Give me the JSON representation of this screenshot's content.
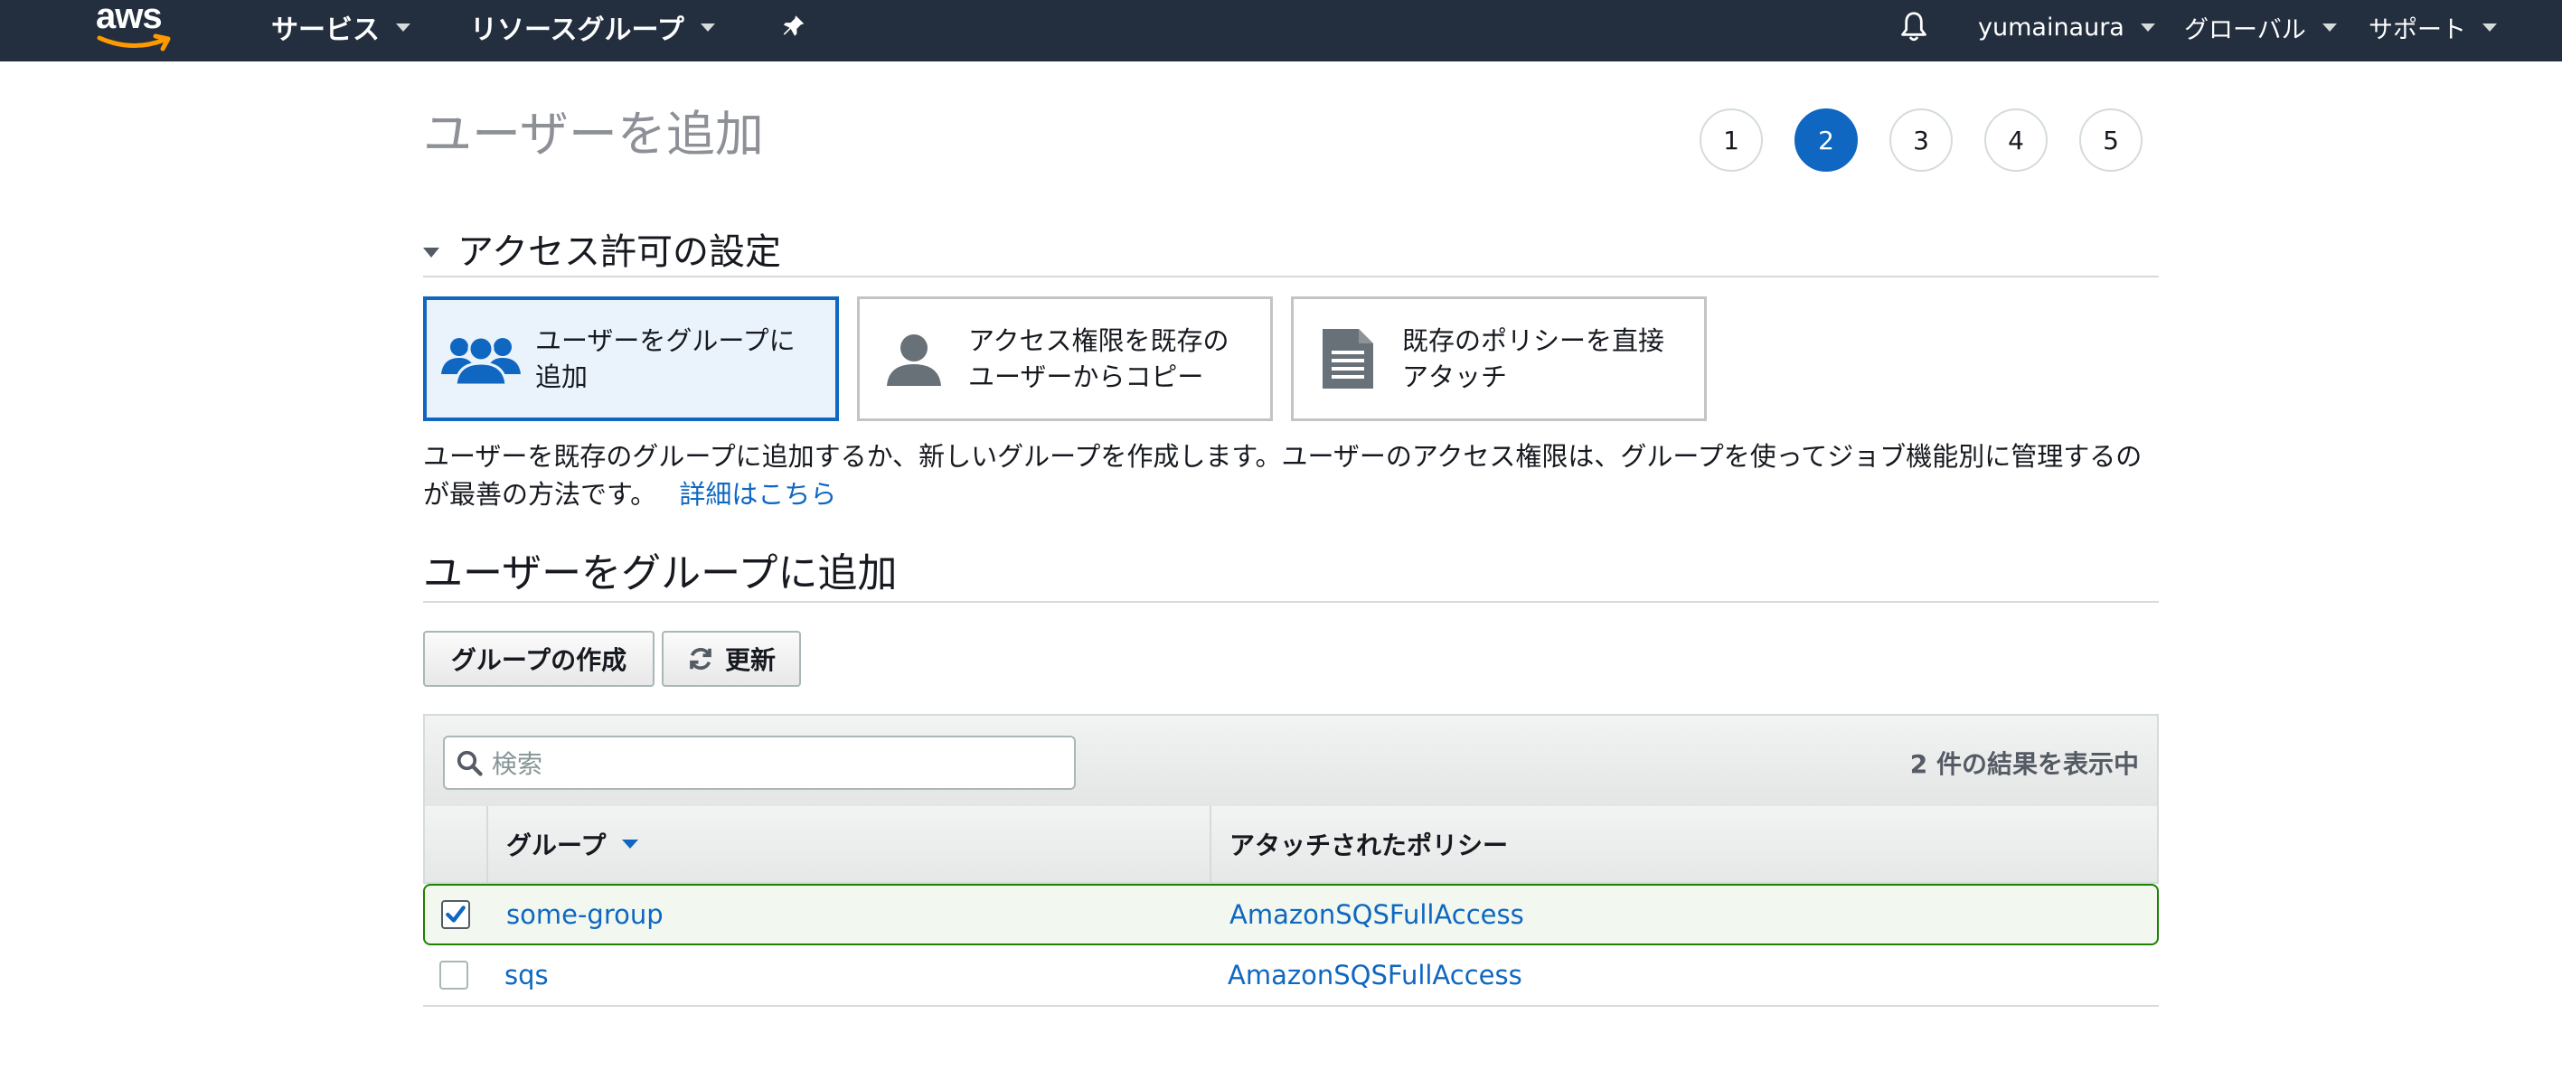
{
  "topnav": {
    "logo": "aws",
    "services": "サービス",
    "resource_groups": "リソースグループ",
    "user": "yumainaura",
    "region": "グローバル",
    "support": "サポート"
  },
  "page": {
    "title": "ユーザーを追加",
    "steps": [
      "1",
      "2",
      "3",
      "4",
      "5"
    ],
    "active_step": "2"
  },
  "permissions": {
    "heading": "アクセス許可の設定",
    "options": [
      {
        "label": "ユーザーをグループに追加",
        "icon": "group-icon",
        "selected": true
      },
      {
        "label": "アクセス権限を既存のユーザーからコピー",
        "icon": "user-icon",
        "selected": false
      },
      {
        "label": "既存のポリシーを直接アタッチ",
        "icon": "document-icon",
        "selected": false
      }
    ],
    "description": "ユーザーを既存のグループに追加するか、新しいグループを作成します。ユーザーのアクセス権限は、グループを使ってジョブ機能別に管理するのが最善の方法です。",
    "learn_more": "詳細はこちら"
  },
  "groups": {
    "heading": "ユーザーをグループに追加",
    "create_button": "グループの作成",
    "refresh_button": "更新",
    "search_placeholder": "検索",
    "results_text": "2 件の結果を表示中",
    "columns": {
      "group": "グループ",
      "policy": "アタッチされたポリシー"
    },
    "rows": [
      {
        "group": "some-group",
        "policy": "AmazonSQSFullAccess",
        "checked": true
      },
      {
        "group": "sqs",
        "policy": "AmazonSQSFullAccess",
        "checked": false
      }
    ]
  },
  "colors": {
    "nav_bg": "#232f3e",
    "accent": "#0f67c1",
    "selected_row_border": "#1d8102",
    "aws_smile": "#ff9900"
  }
}
